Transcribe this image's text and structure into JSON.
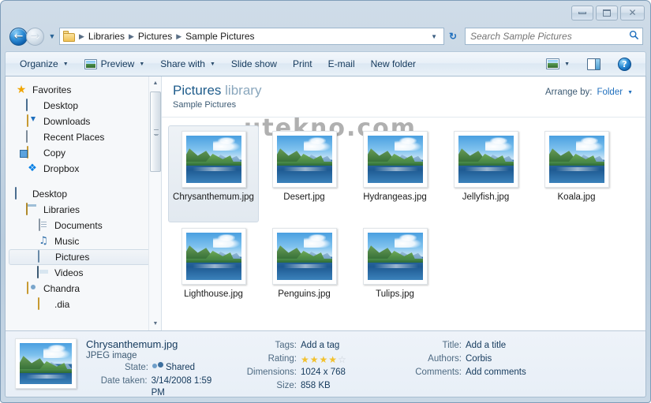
{
  "window": {
    "buttons": {
      "minimize": "Minimize",
      "maximize": "Maximize",
      "close": "Close"
    }
  },
  "nav": {
    "back_label": "Back",
    "forward_label": "Forward",
    "back_glyph": "←",
    "forward_glyph": "→",
    "history_caret": "▼",
    "refresh_glyph": "↻",
    "breadcrumbs": [
      "Libraries",
      "Pictures",
      "Sample Pictures"
    ],
    "separator": "▶",
    "address_caret": "▼"
  },
  "search": {
    "placeholder": "Search Sample Pictures",
    "value": "",
    "icon": "⚲"
  },
  "toolbar": {
    "organize": "Organize",
    "preview": "Preview",
    "share_with": "Share with",
    "slide_show": "Slide show",
    "print": "Print",
    "email": "E-mail",
    "new_folder": "New folder",
    "caret": "▼",
    "help_glyph": "?"
  },
  "sidebar": {
    "items": [
      {
        "label": "Favorites",
        "icon": "star-icon",
        "level": 0,
        "selected": false
      },
      {
        "label": "Desktop",
        "icon": "monitor-icon",
        "level": 1,
        "selected": false
      },
      {
        "label": "Downloads",
        "icon": "downloads-icon",
        "level": 1,
        "selected": false
      },
      {
        "label": "Recent Places",
        "icon": "recent-places-icon",
        "level": 1,
        "selected": false
      },
      {
        "label": "Copy",
        "icon": "copy-folder-icon",
        "level": 1,
        "selected": false
      },
      {
        "label": "Dropbox",
        "icon": "dropbox-icon",
        "level": 1,
        "selected": false
      },
      {
        "label": "Desktop",
        "icon": "monitor-icon",
        "level": 0,
        "selected": false
      },
      {
        "label": "Libraries",
        "icon": "library-icon",
        "level": 1,
        "selected": false
      },
      {
        "label": "Documents",
        "icon": "document-icon",
        "level": 2,
        "selected": false
      },
      {
        "label": "Music",
        "icon": "music-icon",
        "level": 2,
        "selected": false
      },
      {
        "label": "Pictures",
        "icon": "pictures-icon",
        "level": 2,
        "selected": true
      },
      {
        "label": "Videos",
        "icon": "videos-icon",
        "level": 2,
        "selected": false
      },
      {
        "label": "Chandra",
        "icon": "user-folder-icon",
        "level": 1,
        "selected": false
      },
      {
        "label": ".dia",
        "icon": "folder-icon",
        "level": 2,
        "selected": false
      }
    ]
  },
  "library": {
    "title_primary": "Pictures",
    "title_secondary": "library",
    "subtitle": "Sample Pictures",
    "arrange_label": "Arrange by:",
    "arrange_value": "Folder",
    "arrange_caret": "▼"
  },
  "watermark": "utekno.com",
  "files": [
    {
      "name": "Chrysanthemum.jpg",
      "selected": true
    },
    {
      "name": "Desert.jpg",
      "selected": false
    },
    {
      "name": "Hydrangeas.jpg",
      "selected": false
    },
    {
      "name": "Jellyfish.jpg",
      "selected": false
    },
    {
      "name": "Koala.jpg",
      "selected": false
    },
    {
      "name": "Lighthouse.jpg",
      "selected": false
    },
    {
      "name": "Penguins.jpg",
      "selected": false
    },
    {
      "name": "Tulips.jpg",
      "selected": false
    }
  ],
  "details": {
    "filename": "Chrysanthemum.jpg",
    "filetype": "JPEG image",
    "state_label": "State:",
    "state_value": "Shared",
    "date_taken_label": "Date taken:",
    "date_taken_value": "3/14/2008 1:59 PM",
    "tags_label": "Tags:",
    "tags_value": "Add a tag",
    "rating_label": "Rating:",
    "rating_value": 4,
    "rating_max": 5,
    "star_full": "★",
    "star_empty": "☆",
    "dimensions_label": "Dimensions:",
    "dimensions_value": "1024 x 768",
    "size_label": "Size:",
    "size_value": "858 KB",
    "title_label": "Title:",
    "title_value": "Add a title",
    "authors_label": "Authors:",
    "authors_value": "Corbis",
    "comments_label": "Comments:",
    "comments_value": "Add comments"
  },
  "colors": {
    "accent_blue": "#1f6fbd",
    "library_title": "#1f5c8b",
    "star_gold": "#f2c12e",
    "frame": "#7f9db9"
  }
}
